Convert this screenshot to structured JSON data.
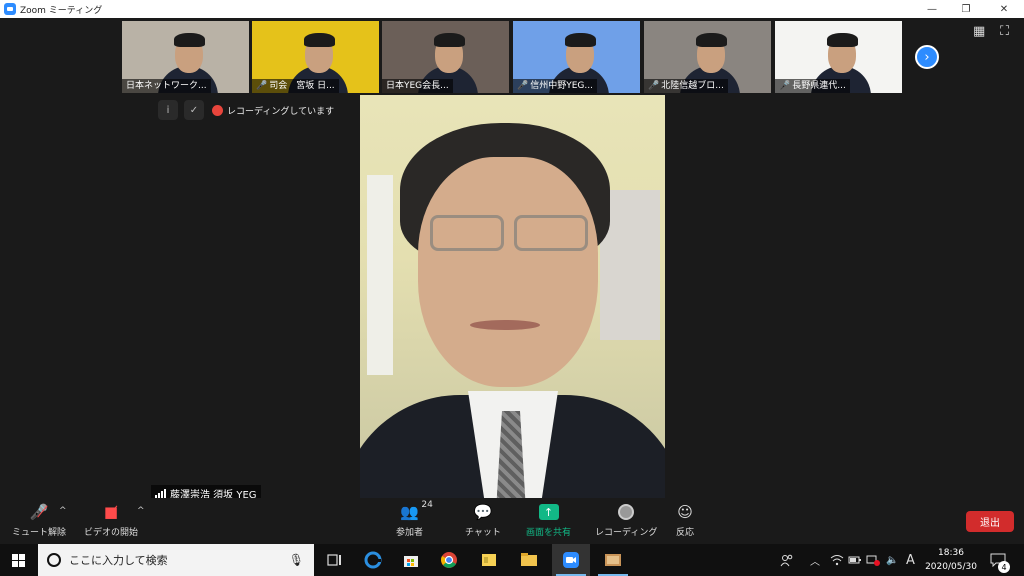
{
  "window": {
    "title": "Zoom ミーティング",
    "minimize_glyph": "—",
    "restore_glyph": "❐",
    "close_glyph": "✕"
  },
  "top_controls": {
    "gallery_view_icon": "grid-icon",
    "fullscreen_icon": "fullscreen-icon",
    "next_page_glyph": "›"
  },
  "thumbnails": [
    {
      "name": "日本ネットワーク...",
      "muted": false,
      "bg": "#b9b2a6"
    },
    {
      "name": "司会　宮坂 日...",
      "muted": true,
      "bg": "#e5c21a"
    },
    {
      "name": "日本YEG会長...",
      "muted": false,
      "bg": "#6b5f58"
    },
    {
      "name": "信州中野YEG...",
      "muted": true,
      "bg": "#6fa0e8"
    },
    {
      "name": "北陸信越ブロ...",
      "muted": true,
      "bg": "#8a8580"
    },
    {
      "name": "長野県連代...",
      "muted": true,
      "bg": "#f4f4f2"
    }
  ],
  "recording": {
    "label": "レコーディングしています",
    "info_icon": "info-icon",
    "shield_icon": "shield-check-icon"
  },
  "active_speaker": {
    "name": "藤澤崇浩 須坂 YEG"
  },
  "toolbar": {
    "unmute_label": "ミュート解除",
    "start_video_label": "ビデオの開始",
    "participants_label": "参加者",
    "participants_count": "24",
    "chat_label": "チャット",
    "share_label": "画面を共有",
    "record_label": "レコーディング",
    "reactions_label": "反応",
    "leave_label": "退出",
    "caret_glyph": "^"
  },
  "taskbar": {
    "search_placeholder": "ここに入力して検索",
    "time": "18:36",
    "date": "2020/05/30",
    "ime_indicator": "A",
    "notification_count": "4",
    "apps": [
      "task-view-icon",
      "edge-icon",
      "store-icon",
      "chrome-icon",
      "sticky-notes-icon",
      "file-explorer-icon",
      "zoom-icon",
      "photo-app-icon"
    ]
  },
  "colors": {
    "zoom_blue": "#2d8cff",
    "share_green": "#12b886",
    "leave_red": "#d22c2c",
    "muted_red": "#ff4b4b"
  }
}
